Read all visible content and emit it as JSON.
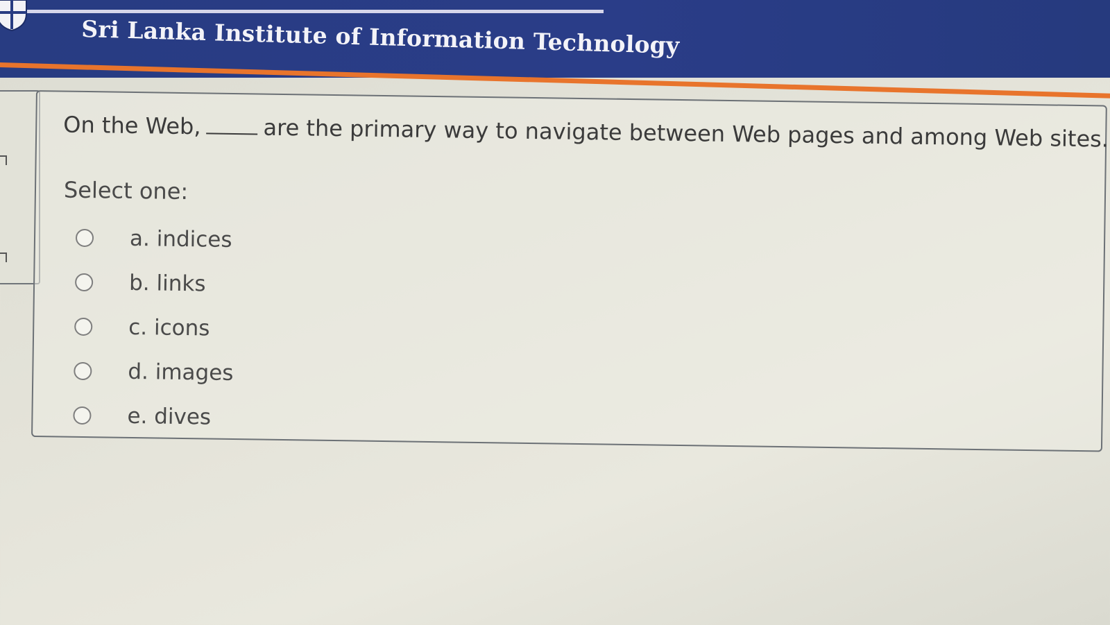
{
  "header": {
    "title": "Sri Lanka Institute of Information Technology",
    "logo_icon": "sliit-crest-icon"
  },
  "question": {
    "text_before": "On the Web,",
    "text_after": "are the primary way to navigate between Web pages and among Web sites.",
    "prompt": "Select one:",
    "options": [
      {
        "label": "a. indices",
        "selected": false
      },
      {
        "label": "b. links",
        "selected": false
      },
      {
        "label": "c. icons",
        "selected": false
      },
      {
        "label": "d. images",
        "selected": false
      },
      {
        "label": "e. dives",
        "selected": false
      }
    ]
  },
  "colors": {
    "header_bg": "#283c82",
    "header_accent": "#e8742c",
    "header_text": "#f3f3f8"
  }
}
